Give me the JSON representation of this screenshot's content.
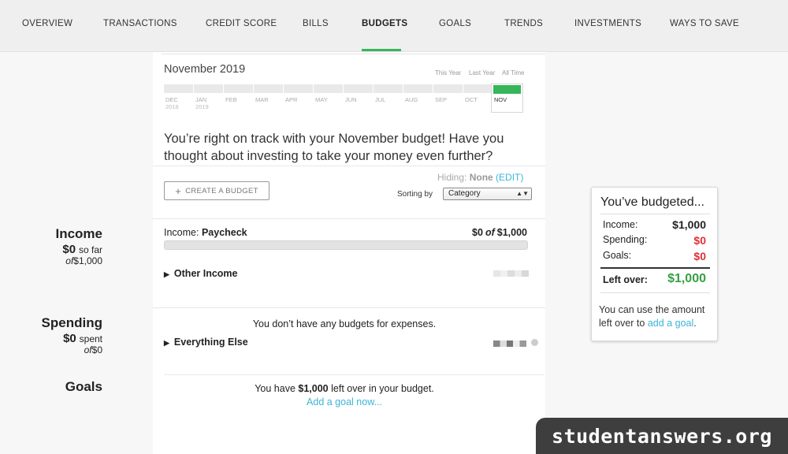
{
  "nav": {
    "items": [
      "OVERVIEW",
      "TRANSACTIONS",
      "CREDIT SCORE",
      "BILLS",
      "BUDGETS",
      "GOALS",
      "TRENDS",
      "INVESTMENTS",
      "WAYS TO SAVE"
    ],
    "active": "BUDGETS"
  },
  "timeline": {
    "title": "November 2019",
    "ranges": [
      "This Year",
      "Last Year",
      "All Time"
    ],
    "months": [
      {
        "label": "DEC",
        "year": "2018"
      },
      {
        "label": "JAN",
        "year": "2019"
      },
      {
        "label": "FEB",
        "year": ""
      },
      {
        "label": "MAR",
        "year": ""
      },
      {
        "label": "APR",
        "year": ""
      },
      {
        "label": "MAY",
        "year": ""
      },
      {
        "label": "JUN",
        "year": ""
      },
      {
        "label": "JUL",
        "year": ""
      },
      {
        "label": "AUG",
        "year": ""
      },
      {
        "label": "SEP",
        "year": ""
      },
      {
        "label": "OCT",
        "year": ""
      }
    ],
    "selected": "NOV"
  },
  "message": "You’re right on track with your November budget! Have you thought about investing to take your money even further?",
  "controls": {
    "hiding_label": "Hiding:",
    "hiding_value": "None",
    "edit": "(EDIT)",
    "create_budget": "CREATE A BUDGET",
    "sorting_label": "Sorting by",
    "sorting_value": "Category"
  },
  "income": {
    "side_title": "Income",
    "side_amount": "$0",
    "side_suffix": "so far",
    "side_of": "of",
    "side_total": "$1,000",
    "row_prefix": "Income:",
    "row_name": "Paycheck",
    "row_spent": "$0",
    "row_of": "of",
    "row_total": "$1,000",
    "progress": 0,
    "other": "Other Income"
  },
  "spending": {
    "side_title": "Spending",
    "side_amount": "$0",
    "side_suffix": "spent",
    "side_of": "of",
    "side_total": "$0",
    "empty_msg": "You don’t have any budgets for expenses.",
    "everything_else": "Everything Else"
  },
  "goals": {
    "side_title": "Goals",
    "leftover_pre": "You have",
    "leftover_amount": "$1,000",
    "leftover_post": "left over in your budget.",
    "add_link": "Add a goal now..."
  },
  "summary": {
    "title": "You’ve budgeted...",
    "income_label": "Income:",
    "income_value": "$1,000",
    "spending_label": "Spending:",
    "spending_value": "$0",
    "goals_label": "Goals:",
    "goals_value": "$0",
    "leftover_label": "Left over:",
    "leftover_value": "$1,000",
    "note_pre": "You can use the amount left over to",
    "note_link": "add a goal",
    "note_post": "."
  },
  "colors": {
    "accent_green": "#35b65a",
    "link_blue": "#3cb4d8",
    "red": "#e02f36",
    "leftover_green": "#35a043"
  },
  "watermark": "studentanswers.org"
}
